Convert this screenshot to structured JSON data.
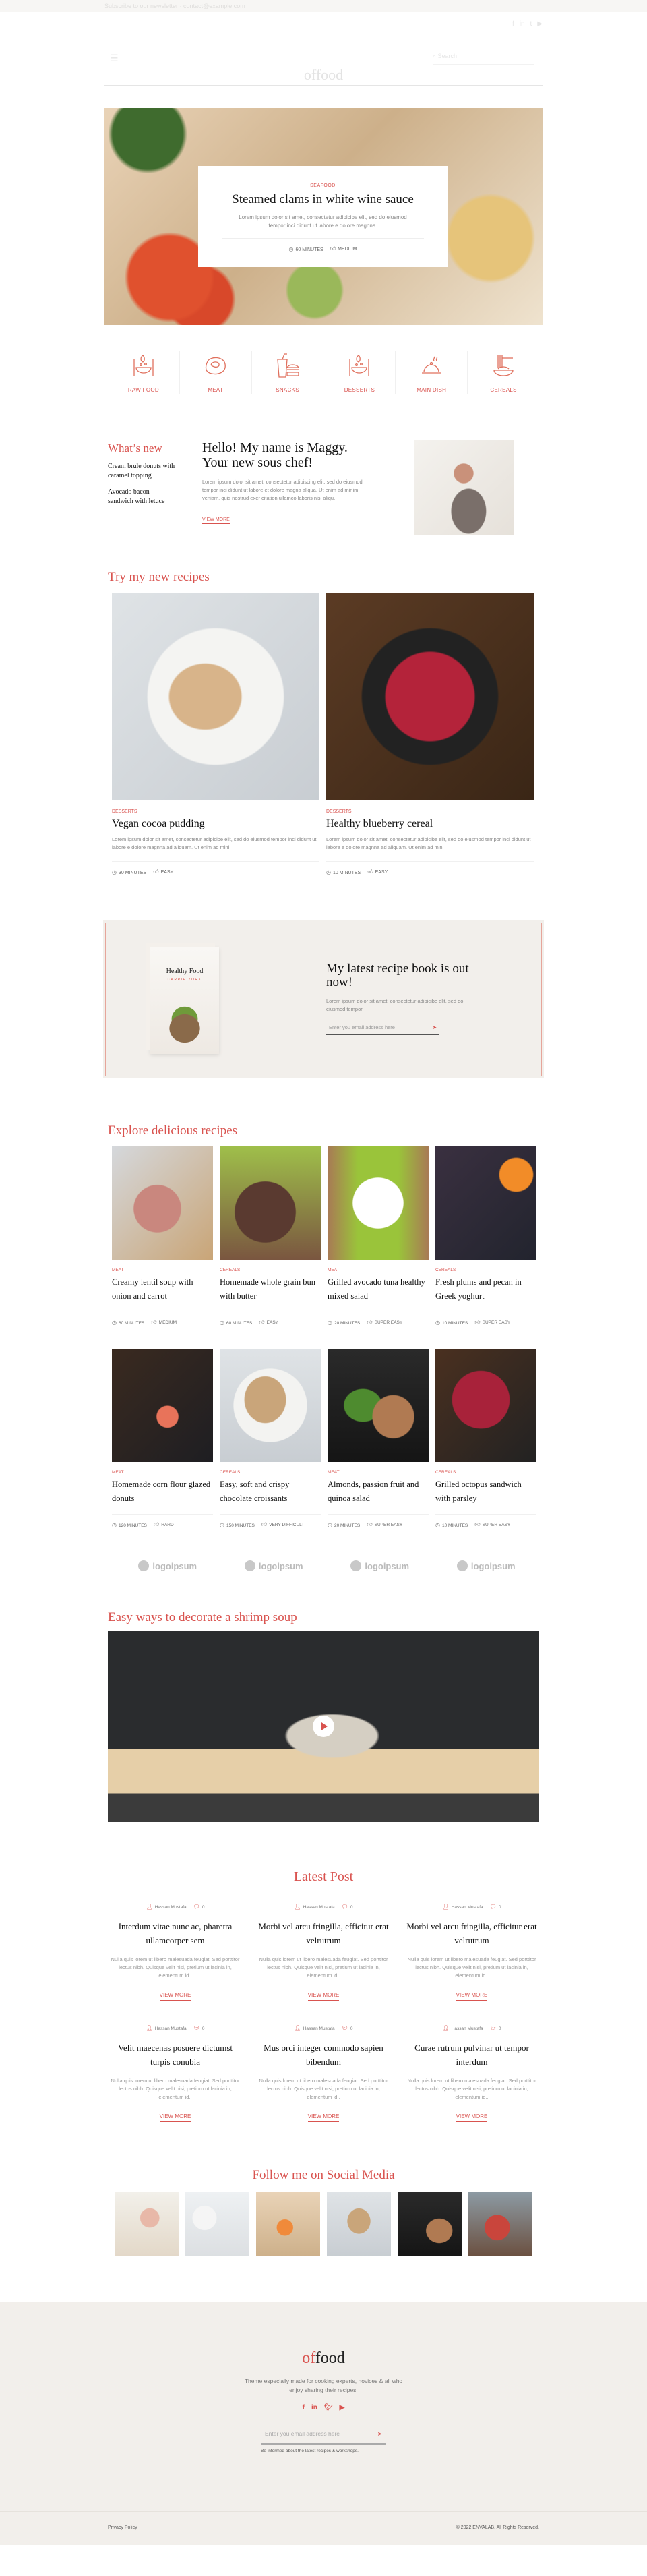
{
  "header": {
    "contact_email": "Subscribe to our newsletter · contact@example.com",
    "social_icons": [
      "facebook-icon",
      "linkedin-icon",
      "twitter-icon",
      "youtube-icon"
    ],
    "logo_prefix": "of",
    "logo_suffix": "food",
    "search_placeholder": "Search"
  },
  "hero": {
    "category": "SEAFOOD",
    "title": "Steamed clams in white wine sauce",
    "description": "Lorem ipsum dolor sit amet, consectetur adipicibe elit, sed do eiusmod tempor inci didunt ut labore e dolore magnna.",
    "time": "60 MINUTES",
    "difficulty": "MEDIUM"
  },
  "categories": [
    {
      "label": "RAW FOOD",
      "icon": "bowl-icon"
    },
    {
      "label": "MEAT",
      "icon": "steak-icon"
    },
    {
      "label": "SNACKS",
      "icon": "burger-icon"
    },
    {
      "label": "DESSERTS",
      "icon": "bowl-icon"
    },
    {
      "label": "MAIN DISH",
      "icon": "cloche-icon"
    },
    {
      "label": "CEREALS",
      "icon": "noodles-icon"
    }
  ],
  "whats_new": {
    "title": "What’s new",
    "items": [
      "Cream brule donuts with caramel topping",
      "Avocado bacon sandwich with letuce"
    ]
  },
  "intro": {
    "title_line1": "Hello! My name is Maggy.",
    "title_line2": "Your new sous chef!",
    "text": "Lorem ipsum dolor sit amet, consectetur adipiscing elit, sed do eiusmod tempor inci didunt ut labore et dolore magna aliqua. Ut enim ad minim veniam, quis nostrud exer citation ullamco laboris nisi aliqu.",
    "link": "VIEW MORE"
  },
  "new_recipes": {
    "title": "Try my new recipes",
    "items": [
      {
        "category": "DESSERTS",
        "title": "Vegan cocoa pudding",
        "text": "Lorem ipsum dolor sit amet, consectetur adipicibe elit, sed do eiusmod tempor inci didunt ut labore e dolore magnna ad aliquam. Ut enim ad mini",
        "time": "30 MINUTES",
        "difficulty": "EASY"
      },
      {
        "category": "DESSERTS",
        "title": "Healthy blueberry cereal",
        "text": "Lorem ipsum dolor sit amet, consectetur adipicibe elit, sed do eiusmod tempor inci didunt ut labore e dolore magnna ad aliquam. Ut enim ad mini",
        "time": "10 MINUTES",
        "difficulty": "EASY"
      }
    ]
  },
  "book": {
    "cover_title": "Healthy Food",
    "cover_author": "CARRIE YORK",
    "title": "My latest recipe book is out now!",
    "text": "Lorem ipsum dolor sit amet, consectetur adipicibe elit, sed do eiusmod tempor.",
    "email_placeholder": "Enter you email address here"
  },
  "explore": {
    "title": "Explore delicious recipes",
    "items": [
      {
        "category": "MEAT",
        "title": "Creamy lentil soup with onion and carrot",
        "time": "60 MINUTES",
        "difficulty": "MEDIUM"
      },
      {
        "category": "CEREALS",
        "title": "Homemade whole grain bun with butter",
        "time": "60 MINUTES",
        "difficulty": "EASY"
      },
      {
        "category": "MEAT",
        "title": "Grilled avocado tuna healthy mixed salad",
        "time": "20 MINUTES",
        "difficulty": "SUPER EASY"
      },
      {
        "category": "CEREALS",
        "title": "Fresh plums and pecan in Greek yoghurt",
        "time": "10 MINUTES",
        "difficulty": "SUPER EASY"
      },
      {
        "category": "MEAT",
        "title": "Homemade corn flour glazed donuts",
        "time": "120 MINUTES",
        "difficulty": "HARD"
      },
      {
        "category": "CEREALS",
        "title": "Easy, soft and crispy chocolate croissants",
        "time": "150 MINUTES",
        "difficulty": "VERY DIFFICULT"
      },
      {
        "category": "MEAT",
        "title": "Almonds, passion fruit and quinoa salad",
        "time": "20 MINUTES",
        "difficulty": "SUPER EASY"
      },
      {
        "category": "CEREALS",
        "title": "Grilled octopus sandwich with parsley",
        "time": "10 MINUTES",
        "difficulty": "SUPER EASY"
      }
    ]
  },
  "partners": [
    "logoipsum",
    "logoipsum",
    "logoipsum",
    "logoipsum"
  ],
  "video": {
    "title": "Easy ways to decorate a shrimp soup"
  },
  "latest": {
    "title": "Latest Post",
    "posts": [
      {
        "author": "Hassan Mustafa",
        "comments": "0",
        "title": "Interdum vitae nunc ac, pharetra ullamcorper sem",
        "text": "Nulla quis lorem ut libero malesuada feugiat. Sed porttitor lectus nibh. Quisque velit nisi, pretium ut lacinia in, elementum id..",
        "link": "VIEW MORE"
      },
      {
        "author": "Hassan Mustafa",
        "comments": "0",
        "title": "Morbi vel arcu fringilla, efficitur erat velrutrum",
        "text": "Nulla quis lorem ut libero malesuada feugiat. Sed porttitor lectus nibh. Quisque velit nisi, pretium ut lacinia in, elementum id..",
        "link": "VIEW MORE"
      },
      {
        "author": "Hassan Mustafa",
        "comments": "0",
        "title": "Morbi vel arcu fringilla, efficitur erat velrutrum",
        "text": "Nulla quis lorem ut libero malesuada feugiat. Sed porttitor lectus nibh. Quisque velit nisi, pretium ut lacinia in, elementum id..",
        "link": "VIEW MORE"
      },
      {
        "author": "Hassan Mustafa",
        "comments": "0",
        "title": "Velit maecenas posuere dictumst turpis conubia",
        "text": "Nulla quis lorem ut libero malesuada feugiat. Sed porttitor lectus nibh. Quisque velit nisi, pretium ut lacinia in, elementum id..",
        "link": "VIEW MORE"
      },
      {
        "author": "Hassan Mustafa",
        "comments": "0",
        "title": "Mus orci integer commodo sapien bibendum",
        "text": "Nulla quis lorem ut libero malesuada feugiat. Sed porttitor lectus nibh. Quisque velit nisi, pretium ut lacinia in, elementum id..",
        "link": "VIEW MORE"
      },
      {
        "author": "Hassan Mustafa",
        "comments": "0",
        "title": "Curae rutrum pulvinar ut tempor interdum",
        "text": "Nulla quis lorem ut libero malesuada feugiat. Sed porttitor lectus nibh. Quisque velit nisi, pretium ut lacinia in, elementum id..",
        "link": "VIEW MORE"
      }
    ]
  },
  "social": {
    "title": "Follow me on Social Media"
  },
  "footer": {
    "logo_prefix": "of",
    "logo_suffix": "food",
    "tagline": "Theme especially made for cooking experts, novices & all who enjoy sharing their recipes.",
    "email_placeholder": "Enter you email address here",
    "note": "Be informed about the latest recipes & workshops.",
    "privacy": "Privacy Policy",
    "copyright": "© 2022 ENVALAB. All Rights Reserved."
  },
  "colors": {
    "accent": "#d9534f",
    "footer_bg": "#f2efeb",
    "text": "#111111",
    "muted": "#888888"
  }
}
